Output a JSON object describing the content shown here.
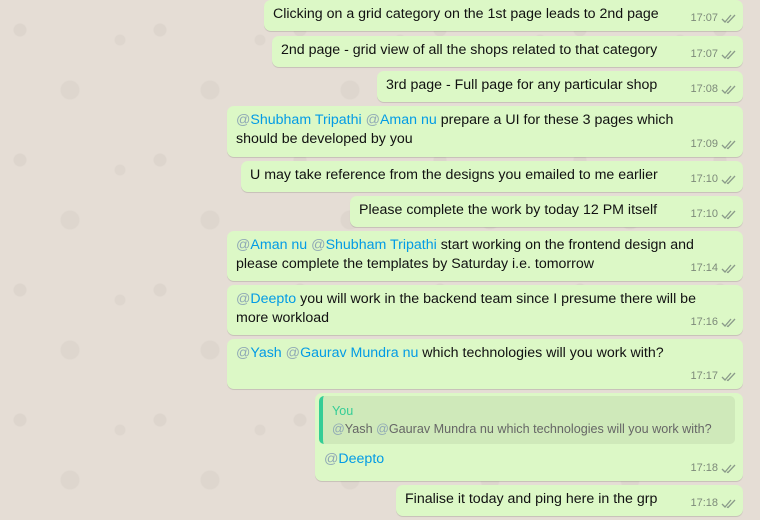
{
  "messages": [
    {
      "text": "Clicking on a grid category on the 1st page leads to 2nd page",
      "time": "17:07"
    },
    {
      "text": "2nd page - grid view of all the shops related to that category",
      "time": "17:07"
    },
    {
      "text": "3rd page - Full page for any particular shop",
      "time": "17:08"
    },
    {
      "m1": "Shubham Tripathi",
      "m2": "Aman nu",
      "text": " prepare a UI for these 3 pages which should be developed by you",
      "time": "17:09"
    },
    {
      "text": "U may take reference from the designs you emailed to me earlier",
      "time": "17:10"
    },
    {
      "text": "Please complete the work by today 12 PM itself",
      "time": "17:10"
    },
    {
      "m1": "Aman nu",
      "m2": "Shubham Tripathi",
      "text": " start working on the frontend design and please complete the templates by Saturday i.e. tomorrow",
      "time": "17:14"
    },
    {
      "m1": "Deepto",
      "text": " you will work in the backend team since I presume there will be more workload",
      "time": "17:16"
    },
    {
      "m1": "Yash",
      "m2": "Gaurav Mundra nu",
      "text": " which technologies will you work with?",
      "time": "17:17"
    },
    {
      "quote_author": "You",
      "quote_m1": "Yash",
      "quote_m2": "Gaurav Mundra nu",
      "quote_text": " which technologies will you work with?",
      "m1": "Deepto",
      "time": "17:18"
    },
    {
      "text": "Finalise it today and ping here in the grp",
      "time": "17:18"
    }
  ],
  "colors": {
    "bubble": "#dcf8c6",
    "mention": "#039be5",
    "tick": "#8a9a8a",
    "quote_bar": "#35cd96"
  },
  "icons": {
    "status": "double-check-icon"
  }
}
